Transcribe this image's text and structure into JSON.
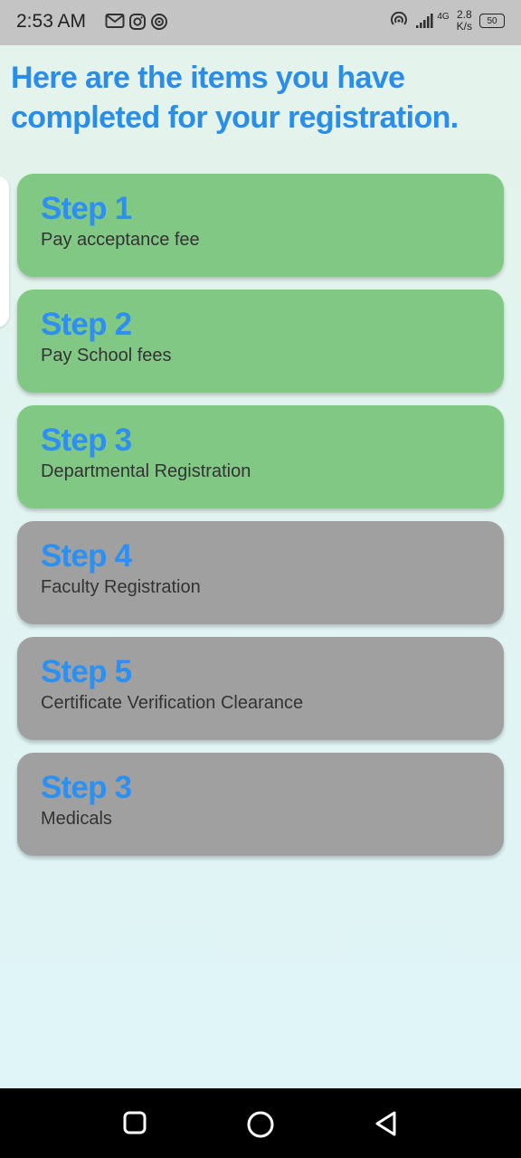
{
  "status_bar": {
    "time": "2:53 AM",
    "network_type": "4G",
    "speed_value": "2.8",
    "speed_unit": "K/s",
    "battery": "50",
    "notification_icons": [
      "gmail-icon",
      "instagram-icon",
      "hotspot-icon"
    ]
  },
  "page": {
    "heading": "Here are the items you have completed for your registration."
  },
  "steps": [
    {
      "title": "Step 1",
      "description": "Pay acceptance fee",
      "status": "completed",
      "color": "#80c883"
    },
    {
      "title": "Step 2",
      "description": "Pay School fees",
      "status": "completed",
      "color": "#80c883"
    },
    {
      "title": "Step 3",
      "description": "Departmental Registration",
      "status": "completed",
      "color": "#80c883"
    },
    {
      "title": "Step 4",
      "description": "Faculty Registration",
      "status": "pending",
      "color": "#a0a0a0"
    },
    {
      "title": "Step 5",
      "description": "Certificate Verification Clearance",
      "status": "pending",
      "color": "#a0a0a0"
    },
    {
      "title": "Step 3",
      "description": "Medicals",
      "status": "pending",
      "color": "#a0a0a0"
    }
  ],
  "colors": {
    "accent": "#2a8ee8",
    "completed": "#80c883",
    "pending": "#a0a0a0"
  },
  "nav_bar": {
    "buttons": [
      "recents-icon",
      "home-icon",
      "back-icon"
    ]
  }
}
